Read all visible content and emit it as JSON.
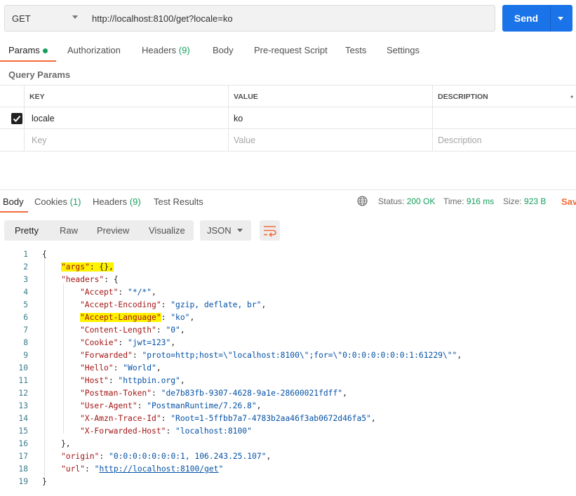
{
  "request": {
    "method": "GET",
    "url": "http://localhost:8100/get?locale=ko",
    "send_label": "Send"
  },
  "request_tabs": [
    {
      "label": "Params",
      "count": ""
    },
    {
      "label": "Authorization",
      "count": ""
    },
    {
      "label": "Headers",
      "count": "(9)"
    },
    {
      "label": "Body",
      "count": ""
    },
    {
      "label": "Pre-request Script",
      "count": ""
    },
    {
      "label": "Tests",
      "count": ""
    },
    {
      "label": "Settings",
      "count": ""
    }
  ],
  "query_params": {
    "title": "Query Params",
    "columns": [
      "KEY",
      "VALUE",
      "DESCRIPTION"
    ],
    "rows": [
      {
        "checked": true,
        "key": "locale",
        "value": "ko",
        "description": ""
      }
    ],
    "placeholders": {
      "key": "Key",
      "value": "Value",
      "description": "Description"
    }
  },
  "response_tabs": [
    {
      "label": "Body",
      "count": ""
    },
    {
      "label": "Cookies",
      "count": "(1)"
    },
    {
      "label": "Headers",
      "count": "(9)"
    },
    {
      "label": "Test Results",
      "count": ""
    }
  ],
  "response_status": {
    "status_label": "Status:",
    "status_value": "200 OK",
    "time_label": "Time:",
    "time_value": "916 ms",
    "size_label": "Size:",
    "size_value": "923 B",
    "save_label": "Sav"
  },
  "view_modes": [
    "Pretty",
    "Raw",
    "Preview",
    "Visualize"
  ],
  "format": "JSON",
  "body_lines": [
    {
      "n": "1",
      "text": "{"
    },
    {
      "n": "2",
      "text": "\"args\": {},"
    },
    {
      "n": "3",
      "text": "\"headers\": {"
    },
    {
      "n": "4",
      "text": "\"Accept\": \"*/*\","
    },
    {
      "n": "5",
      "text": "\"Accept-Encoding\": \"gzip, deflate, br\","
    },
    {
      "n": "6",
      "text": "\"Accept-Language\": \"ko\","
    },
    {
      "n": "7",
      "text": "\"Content-Length\": \"0\","
    },
    {
      "n": "8",
      "text": "\"Cookie\": \"jwt=123\","
    },
    {
      "n": "9",
      "text": "\"Forwarded\": \"proto=http;host=\\\"localhost:8100\\\";for=\\\"0:0:0:0:0:0:0:1:61229\\\"\","
    },
    {
      "n": "10",
      "text": "\"Hello\": \"World\","
    },
    {
      "n": "11",
      "text": "\"Host\": \"httpbin.org\","
    },
    {
      "n": "12",
      "text": "\"Postman-Token\": \"de7b83fb-9307-4628-9a1e-28600021fdff\","
    },
    {
      "n": "13",
      "text": "\"User-Agent\": \"PostmanRuntime/7.26.8\","
    },
    {
      "n": "14",
      "text": "\"X-Amzn-Trace-Id\": \"Root=1-5ffbb7a7-4783b2aa46f3ab0672d46fa5\","
    },
    {
      "n": "15",
      "text": "\"X-Forwarded-Host\": \"localhost:8100\""
    },
    {
      "n": "16",
      "text": "},"
    },
    {
      "n": "17",
      "text": "\"origin\": \"0:0:0:0:0:0:0:1, 106.243.25.107\","
    },
    {
      "n": "18",
      "text": "\"url\": \"http://localhost:8100/get\""
    },
    {
      "n": "19",
      "text": "}"
    }
  ]
}
